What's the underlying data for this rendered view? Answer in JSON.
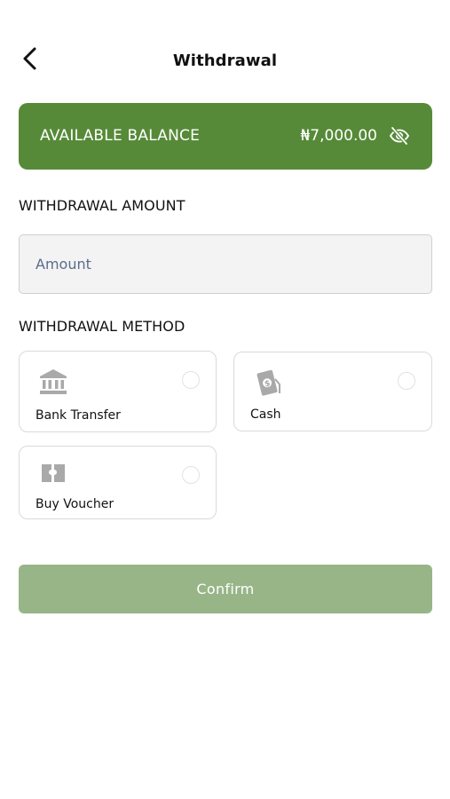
{
  "header": {
    "back_icon": "chevron-left-icon",
    "title": "Withdrawal"
  },
  "balance": {
    "label": "AVAILABLE BALANCE",
    "amount": "₦7,000.00",
    "toggle_icon": "eye-off-icon",
    "card_color": "#568a38"
  },
  "amount_section": {
    "label": "WITHDRAWAL AMOUNT",
    "input_value": "",
    "placeholder": "Amount"
  },
  "method_section": {
    "label": "WITHDRAWAL METHOD",
    "options": [
      {
        "label": "Bank Transfer",
        "icon": "bank-icon",
        "selected": false
      },
      {
        "label": "Cash",
        "icon": "cash-icon",
        "selected": false
      },
      {
        "label": "Buy Voucher",
        "icon": "voucher-icon",
        "selected": false
      }
    ]
  },
  "confirm": {
    "label": "Confirm",
    "disabled_color": "#98b587"
  }
}
